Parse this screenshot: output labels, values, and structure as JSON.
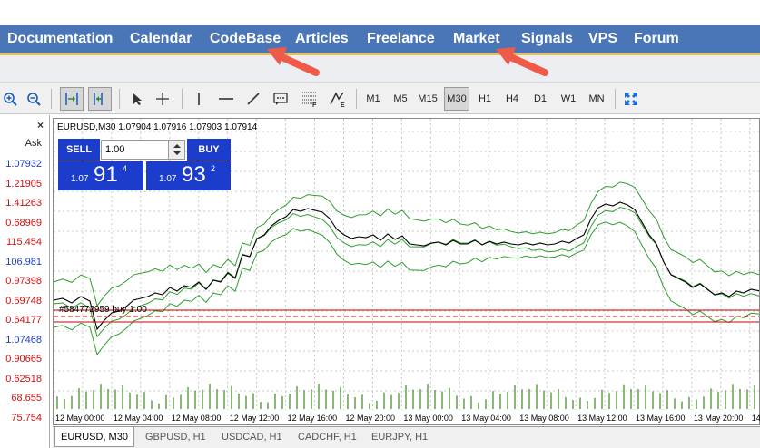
{
  "nav": {
    "items": [
      "Documentation",
      "Calendar",
      "CodeBase",
      "Articles",
      "Freelance",
      "Market",
      "Signals",
      "VPS",
      "Forum"
    ]
  },
  "toolbar": {
    "timeframes": [
      "M1",
      "M5",
      "M15",
      "M30",
      "H1",
      "H4",
      "D1",
      "W1",
      "MN"
    ],
    "selected_timeframe": "M30",
    "icons": [
      "zoom-in-icon",
      "zoom-out-icon",
      "autoscroll-icon",
      "chart-shift-icon",
      "cursor-icon",
      "crosshair-icon",
      "vertical-line-icon",
      "horizontal-line-icon",
      "trendline-icon",
      "text-label-icon",
      "fibonacci-icon",
      "gann-icon",
      "fullscreen-icon"
    ]
  },
  "market_watch": {
    "close": "×",
    "column_header": "Ask",
    "rows": [
      {
        "ask": "1.07932",
        "color": "#1c3ccc"
      },
      {
        "ask": "1.21905",
        "color": "#d01010"
      },
      {
        "ask": "1.41263",
        "color": "#d01010"
      },
      {
        "ask": "0.68969",
        "color": "#d01010"
      },
      {
        "ask": "115.454",
        "color": "#d01010"
      },
      {
        "ask": "106.981",
        "color": "#1c3ccc"
      },
      {
        "ask": "0.97398",
        "color": "#d01010"
      },
      {
        "ask": "0.59748",
        "color": "#d01010"
      },
      {
        "ask": "0.64177",
        "color": "#d01010"
      },
      {
        "ask": "1.07468",
        "color": "#1c3ccc"
      },
      {
        "ask": "0.90665",
        "color": "#d01010"
      },
      {
        "ask": "0.62518",
        "color": "#d01010"
      },
      {
        "ask": "68.655",
        "color": "#d01010"
      },
      {
        "ask": "75.754",
        "color": "#d01010"
      }
    ]
  },
  "chart": {
    "title": "EURUSD,M30  1.07904 1.07916 1.07903 1.07914",
    "order_label": "#584772959 buy 1.00",
    "sell_label": "SELL",
    "buy_label": "BUY",
    "lot_value": "1.00",
    "sell_price_prefix": "1.07",
    "sell_price_big": "91",
    "sell_price_sup": "4",
    "buy_price_prefix": "1.07",
    "buy_price_big": "93",
    "buy_price_sup": "2",
    "x_labels": [
      "12 May 00:00",
      "12 May 04:00",
      "12 May 08:00",
      "12 May 12:00",
      "12 May 16:00",
      "12 May 20:00",
      "13 May 00:00",
      "13 May 04:00",
      "13 May 08:00",
      "13 May 12:00",
      "13 May 16:00",
      "13 May 20:00",
      "14"
    ]
  },
  "tabs": [
    "EURUSD, M30",
    "GBPUSD, H1",
    "USDCAD, H1",
    "CADCHF, H1",
    "EURJPY, H1"
  ],
  "colors": {
    "nav_bg": "#4a76b8",
    "arrow": "#f05a48",
    "price_line": "#000000",
    "bands": "#2e9e2e",
    "volume": "#3a8a1e",
    "order_line": "#cc0000"
  }
}
